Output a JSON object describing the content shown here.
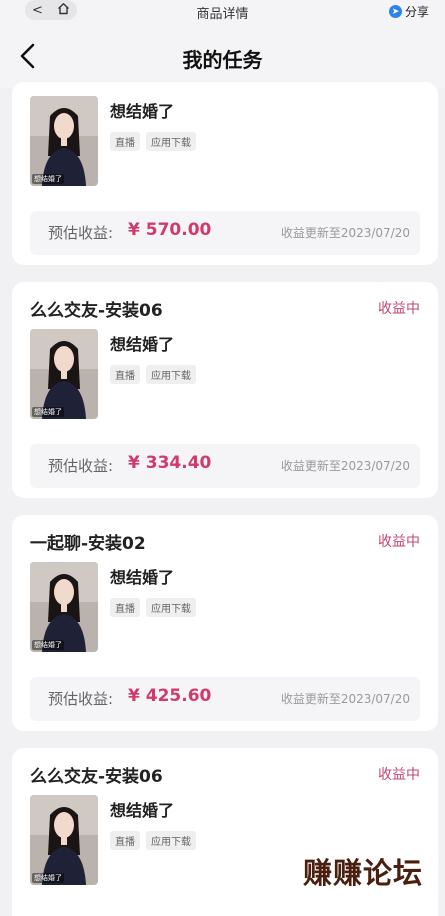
{
  "topbar": {
    "back_glyph": "<",
    "home_icon": "home-icon",
    "title": "商品详情",
    "share_label": "分享"
  },
  "nav": {
    "title": "我的任务"
  },
  "colors": {
    "status": "#c2486e",
    "earnings": "#d13a6b",
    "background": "#f1f1f3"
  },
  "tasks": [
    {
      "title": "",
      "status": "",
      "item_name": "想结婚了",
      "thumb_caption": "想结婚了",
      "tags": [
        "直播",
        "应用下载"
      ],
      "earnings_label": "预估收益:",
      "earnings_value": "¥ 570.00",
      "earnings_date": "收益更新至2023/07/20"
    },
    {
      "title": "么么交友-安装06",
      "status": "收益中",
      "item_name": "想结婚了",
      "thumb_caption": "想结婚了",
      "tags": [
        "直播",
        "应用下载"
      ],
      "earnings_label": "预估收益:",
      "earnings_value": "¥ 334.40",
      "earnings_date": "收益更新至2023/07/20"
    },
    {
      "title": "一起聊-安装02",
      "status": "收益中",
      "item_name": "想结婚了",
      "thumb_caption": "想结婚了",
      "tags": [
        "直播",
        "应用下载"
      ],
      "earnings_label": "预估收益:",
      "earnings_value": "¥ 425.60",
      "earnings_date": "收益更新至2023/07/20"
    },
    {
      "title": "么么交友-安装06",
      "status": "收益中",
      "item_name": "想结婚了",
      "thumb_caption": "想结婚了",
      "tags": [
        "直播",
        "应用下载"
      ]
    }
  ],
  "watermark": "赚赚论坛"
}
